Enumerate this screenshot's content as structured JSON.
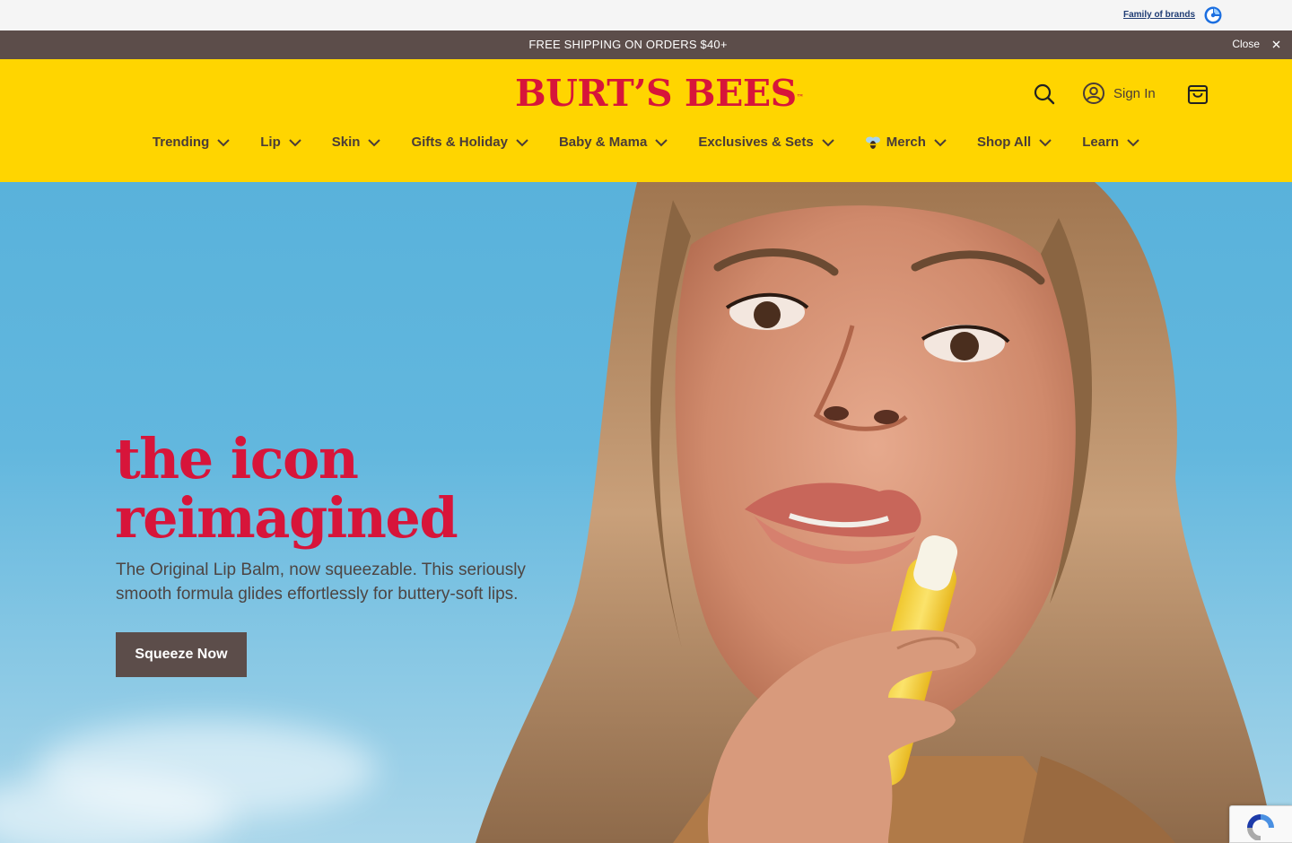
{
  "utility": {
    "family_of_brands": "Family of brands"
  },
  "announcement": {
    "text": "FREE SHIPPING ON ORDERS $40+",
    "close_label": "Close"
  },
  "header": {
    "logo_text": "BURT’S BEES",
    "logo_tm": "™",
    "sign_in": "Sign In"
  },
  "nav": {
    "items": [
      {
        "label": "Trending"
      },
      {
        "label": "Lip"
      },
      {
        "label": "Skin"
      },
      {
        "label": "Gifts & Holiday"
      },
      {
        "label": "Baby & Mama"
      },
      {
        "label": "Exclusives & Sets"
      },
      {
        "label": "Merch",
        "icon": "bee-icon"
      },
      {
        "label": "Shop All"
      },
      {
        "label": "Learn"
      }
    ]
  },
  "hero": {
    "title_line1": "the icon",
    "title_line2": "reimagined",
    "subtitle": "The Original Lip Balm, now squeezable. This seriously smooth formula glides effortlessly for buttery-soft lips.",
    "cta": "Squeeze Now",
    "image": "woman-applying-lip-balm-photo"
  },
  "colors": {
    "brand_yellow": "#ffd500",
    "brand_red": "#d7153a",
    "brand_brown": "#5c4d4a",
    "sky_blue": "#5fb5dd"
  }
}
